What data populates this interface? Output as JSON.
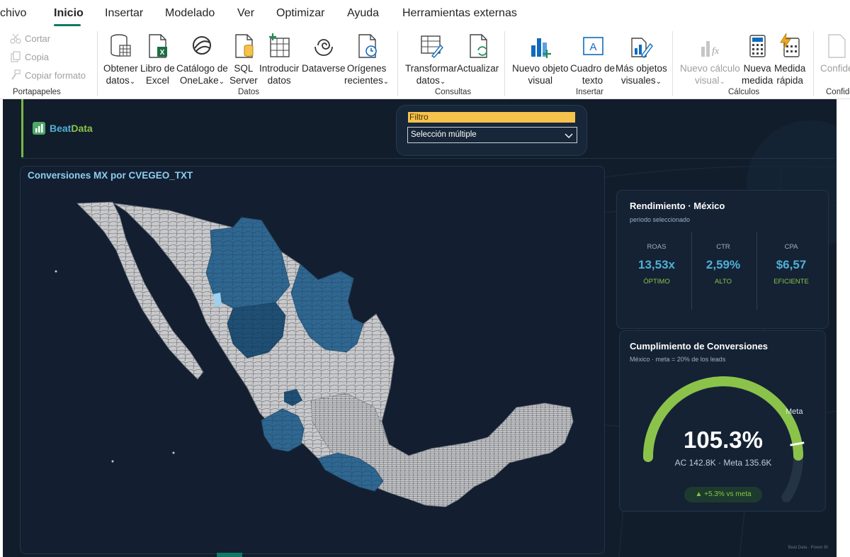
{
  "menu": {
    "tabs": [
      {
        "label": "chivo"
      },
      {
        "label": "Inicio"
      },
      {
        "label": "Insertar"
      },
      {
        "label": "Modelado"
      },
      {
        "label": "Ver"
      },
      {
        "label": "Optimizar"
      },
      {
        "label": "Ayuda"
      },
      {
        "label": "Herramientas externas"
      }
    ]
  },
  "ribbon": {
    "clipboard": {
      "cut": "Cortar",
      "copy": "Copia",
      "format_painter": "Copiar formato",
      "group_label": "Portapapeles"
    },
    "data": {
      "buttons": [
        {
          "line1": "Obtener",
          "line2": "datos"
        },
        {
          "line1": "Libro de",
          "line2": "Excel"
        },
        {
          "line1": "Catálogo de",
          "line2": "OneLake"
        },
        {
          "line1": "SQL",
          "line2": "Server"
        },
        {
          "line1": "Introducir",
          "line2": "datos"
        },
        {
          "line1": "Dataverse",
          "line2": ""
        },
        {
          "line1": "Orígenes",
          "line2": "recientes"
        }
      ],
      "group_label": "Datos"
    },
    "queries": {
      "buttons": [
        {
          "line1": "Transformar",
          "line2": "datos"
        },
        {
          "line1": "Actualizar",
          "line2": ""
        }
      ],
      "group_label": "Consultas"
    },
    "insert": {
      "buttons": [
        {
          "line1": "Nuevo objeto",
          "line2": "visual"
        },
        {
          "line1": "Cuadro de",
          "line2": "texto"
        },
        {
          "line1": "Más objetos",
          "line2": "visuales"
        }
      ],
      "group_label": "Insertar"
    },
    "calculations": {
      "buttons": [
        {
          "line1": "Nuevo cálculo",
          "line2": "visual"
        },
        {
          "line1": "Nueva",
          "line2": "medida"
        },
        {
          "line1": "Medida",
          "line2": "rápida"
        }
      ],
      "group_label": "Cálculos"
    },
    "confidentiality": {
      "button": "Confide",
      "group_label": "Confide"
    },
    "chevron": "⌄"
  },
  "report": {
    "logo": {
      "part1": "Beat",
      "part2": "Data"
    },
    "filter": {
      "title": "Filtro",
      "selected": "Selección múltiple"
    },
    "map": {
      "title": "Conversiones MX por CVEGEO_TXT"
    },
    "performance": {
      "title": "Rendimiento · México",
      "subtitle": "periodo seleccionado",
      "kpis": [
        {
          "label": "ROAS",
          "value": "13,53x",
          "status": "ÓPTIMO"
        },
        {
          "label": "CTR",
          "value": "2,59%",
          "status": "ALTO"
        },
        {
          "label": "CPA",
          "value": "$6,57",
          "status": "EFICIENTE"
        }
      ]
    },
    "conversion": {
      "title": "Cumplimiento de Conversiones",
      "subtitle": "México · meta = 20% de los leads",
      "value": "105.3%",
      "value_fraction": 1.053,
      "detail": "AC 142.8K · Meta 135.6K",
      "meta_label": "Meta",
      "delta": "▲ +5.3% vs meta",
      "gauge_color": "#8bc34a",
      "track_color": "#243445"
    },
    "footer": "Beat Data · Power BI"
  },
  "colors": {
    "accent": "#117865",
    "brand_blue": "#4fb0d6",
    "brand_green": "#8bc34a",
    "filter_header": "#f5c24c",
    "background": "#121d2b"
  }
}
